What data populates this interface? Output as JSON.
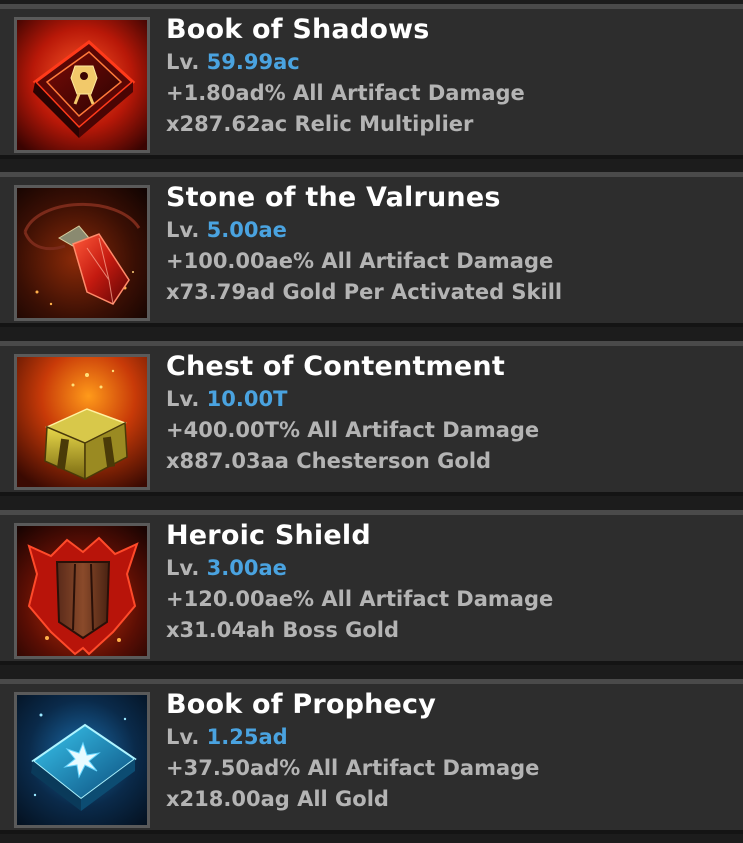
{
  "artifacts": [
    {
      "name": "Book of Shadows",
      "level_prefix": "Lv.",
      "level": "59.99ac",
      "effect": "+1.80ad% All Artifact Damage",
      "bonus": "x287.62ac Relic Multiplier",
      "icon": "book-of-shadows-icon"
    },
    {
      "name": "Stone of the Valrunes",
      "level_prefix": "Lv.",
      "level": "5.00ae",
      "effect": "+100.00ae% All Artifact Damage",
      "bonus": "x73.79ad Gold Per Activated Skill",
      "icon": "stone-of-the-valrunes-icon"
    },
    {
      "name": "Chest of Contentment",
      "level_prefix": "Lv.",
      "level": "10.00T",
      "effect": "+400.00T% All Artifact Damage",
      "bonus": "x887.03aa Chesterson Gold",
      "icon": "chest-of-contentment-icon"
    },
    {
      "name": "Heroic Shield",
      "level_prefix": "Lv.",
      "level": "3.00ae",
      "effect": "+120.00ae% All Artifact Damage",
      "bonus": "x31.04ah Boss Gold",
      "icon": "heroic-shield-icon"
    },
    {
      "name": "Book of Prophecy",
      "level_prefix": "Lv.",
      "level": "1.25ad",
      "effect": "+37.50ad% All Artifact Damage",
      "bonus": "x218.00ag All Gold",
      "icon": "book-of-prophecy-icon"
    }
  ],
  "colors": {
    "card_background": "#2d2d2d",
    "name_text": "#ffffff",
    "stat_text": "#b4b4b4",
    "level_value": "#4aa3e0"
  }
}
